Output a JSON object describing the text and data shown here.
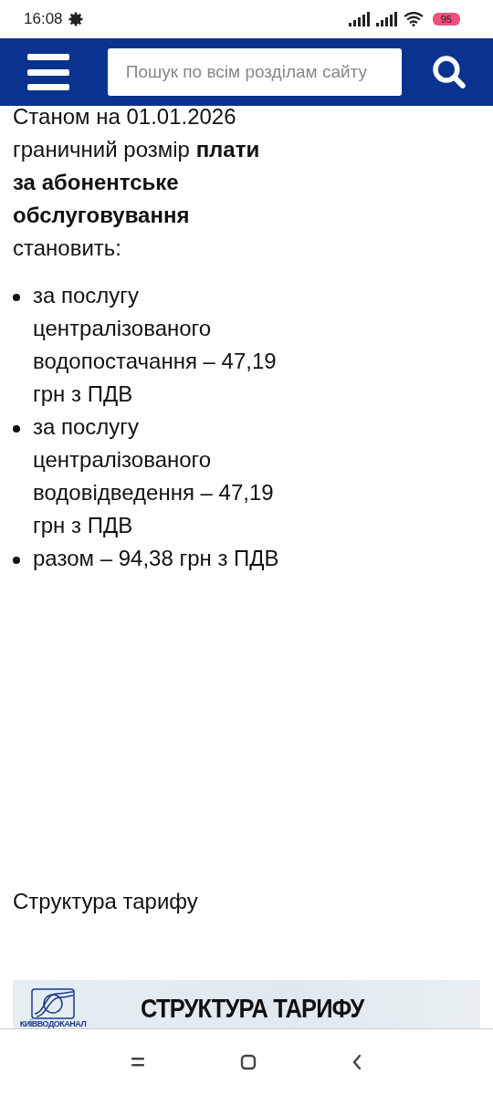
{
  "status_bar": {
    "time": "16:08",
    "battery": "95"
  },
  "header": {
    "search": {
      "placeholder": "Пошук по всім розділам сайту"
    }
  },
  "intro": "Станом на 01.01.2026 граничний розмір **плати за абонентське обслуговування** становить:",
  "items": [
    "за послугу централізованого водопостачання – 47,19 грн з ПДВ",
    "за послугу централізованого водовідведення – 47,19 грн з ПДВ",
    "разом – 94,38 грн з ПДВ"
  ],
  "section_title": "Структура тарифу",
  "banner": {
    "logo_label": "КИЇВВОДОКАНАЛ",
    "title": "СТРУКТУРА ТАРИФУ"
  }
}
